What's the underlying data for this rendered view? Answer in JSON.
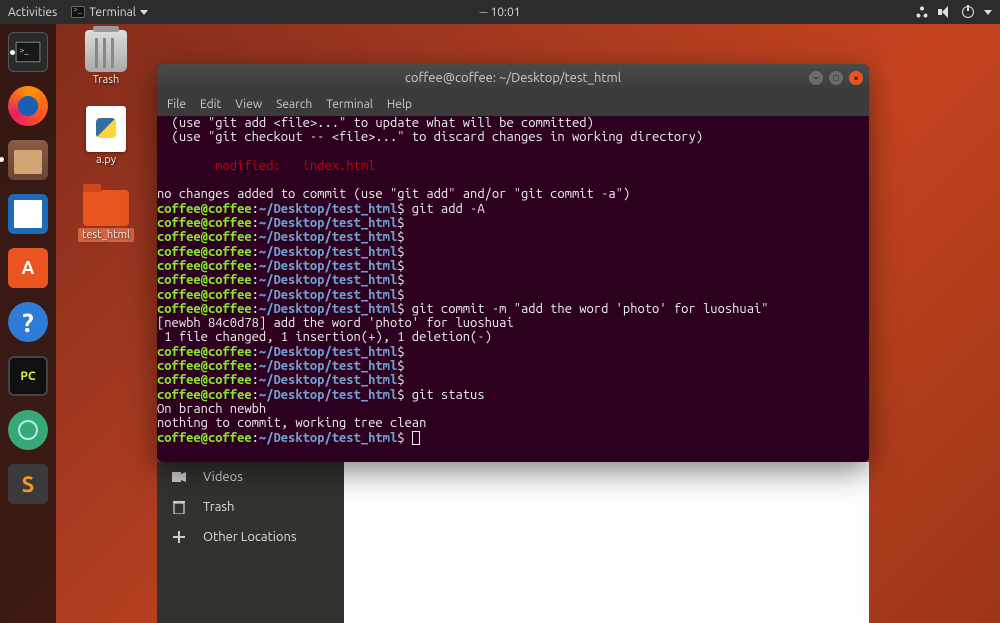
{
  "topbar": {
    "activities": "Activities",
    "app_indicator": "Terminal",
    "time": "10:01"
  },
  "desktop": {
    "trash": "Trash",
    "apy": "a.py",
    "folder": "test_html"
  },
  "terminal": {
    "title": "coffee@coffee: ~/Desktop/test_html",
    "menu": {
      "file": "File",
      "edit": "Edit",
      "view": "View",
      "search": "Search",
      "terminal": "Terminal",
      "help": "Help"
    },
    "prompt": {
      "user": "coffee@coffee",
      "sep": ":",
      "path": "~/Desktop/test_html",
      "sym": "$"
    },
    "lines": {
      "hint1": "  (use \"git add <file>...\" to update what will be committed)",
      "hint2": "  (use \"git checkout -- <file>...\" to discard changes in working directory)",
      "mod_label": "        modified:   ",
      "mod_file": "index.html",
      "no_changes": "no changes added to commit (use \"git add\" and/or \"git commit -a\")",
      "cmd_add": " git add -A",
      "cmd_commit": " git commit -m \"add the word 'photo' for luoshuai\"",
      "commit_out1": "[newbh 84c0d78] add the word 'photo' for luoshuai",
      "commit_out2": " 1 file changed, 1 insertion(+), 1 deletion(-)",
      "cmd_status": " git status",
      "branch": "On branch newbh",
      "clean": "nothing to commit, working tree clean",
      "space": " "
    }
  },
  "files_sidebar": {
    "videos": "Videos",
    "trash": "Trash",
    "other": "Other Locations"
  }
}
